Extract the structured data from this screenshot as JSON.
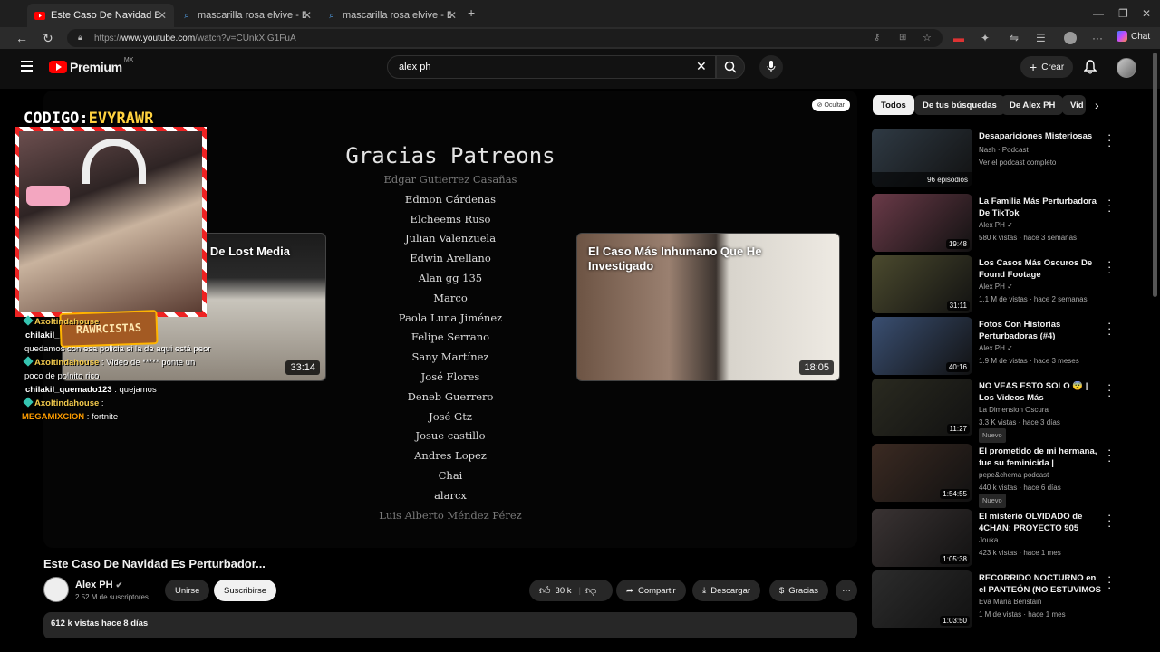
{
  "browser": {
    "tabs": [
      {
        "title": "Este Caso De Navidad Es Perturbador",
        "active": true
      },
      {
        "title": "mascarilla rosa elvive - Búsqueda",
        "active": false
      },
      {
        "title": "mascarilla rosa elvive - Búsqueda",
        "active": false
      }
    ],
    "new_tab": "+",
    "url_prefix": "https://",
    "url_domain": "www.youtube.com",
    "url_path": "/watch?v=CUnkXIG1FuA",
    "chat_label": "Chat"
  },
  "header": {
    "brand": "Premium",
    "region": "MX",
    "search_value": "alex ph",
    "create_label": "Crear"
  },
  "player": {
    "hide_label": "Ocultar",
    "credits_title": "Gracias Patreons",
    "credits": [
      "Edgar Gutierrez Casañas",
      "Edmon Cárdenas",
      "Elcheems Ruso",
      "Julian Valenzuela",
      "Edwin Arellano",
      "Alan gg 135",
      "Marco",
      "Paola Luna Jiménez",
      "Felipe Serrano",
      "Sany Martínez",
      "José Flores",
      "Deneb Guerrero",
      "José Gtz",
      "Josue castillo",
      "Andres Lopez",
      "Chai",
      "alarcx",
      "Luis Alberto Méndez Pérez"
    ],
    "end_card_left": {
      "title": "s De Lost Media",
      "duration": "33:14"
    },
    "end_card_right": {
      "title": "El Caso Más Inhumano Que He Investigado",
      "duration": "18:05"
    }
  },
  "overlay": {
    "code_label": "CODIGO:",
    "code_value": "EVYRAWR",
    "badge": "RAWRCISTAS",
    "chat": [
      {
        "user": "Axoltindahouse",
        "text": ""
      },
      {
        "user": "chilakil_",
        "text": ""
      },
      {
        "user": "",
        "text": "quedamos con esa policia si la de aqui está peor"
      },
      {
        "user": "Axoltindahouse",
        "text": ": Video de ***** ponte un poco de polnito rico"
      },
      {
        "user": "chilakil_quemado123",
        "text": ": quejamos"
      },
      {
        "user": "Axoltindahouse",
        "text": ":"
      },
      {
        "user": "MEGAMIXCION",
        "text": ": fortnite"
      }
    ]
  },
  "video": {
    "title": "Este Caso De Navidad Es Perturbador...",
    "channel": "Alex PH",
    "subscribers": "2.52 M de suscriptores",
    "join_label": "Unirse",
    "subscribe_label": "Suscribirse",
    "likes": "30 k",
    "share_label": "Compartir",
    "download_label": "Descargar",
    "thanks_label": "Gracias",
    "views_date": "612 k vistas  hace 8 días"
  },
  "sidebar": {
    "chips": [
      "Todos",
      "De tus búsquedas",
      "De Alex PH",
      "Vid"
    ],
    "items": [
      {
        "title": "Desapariciones Misteriosas",
        "line1": "Nash · Podcast",
        "line2": "Ver el podcast completo",
        "duration": "96 episodios",
        "thumb_color": "#2f3a44",
        "new": false
      },
      {
        "title": "La Familia Más Perturbadora De TikTok",
        "line1": "Alex PH ✓",
        "line2": "580 k vistas · hace 3 semanas",
        "duration": "19:48",
        "thumb_color": "#6a3a48",
        "new": false
      },
      {
        "title": "Los Casos Más Oscuros De Found Footage",
        "line1": "Alex PH ✓",
        "line2": "1.1 M de vistas · hace 2 semanas",
        "duration": "31:11",
        "thumb_color": "#4b4a2e",
        "new": false
      },
      {
        "title": "Fotos Con Historias Perturbadoras (#4)",
        "line1": "Alex PH ✓",
        "line2": "1.9 M de vistas · hace 3 meses",
        "duration": "40:16",
        "thumb_color": "#3a4f72",
        "new": false
      },
      {
        "title": "NO VEAS ESTO SOLO 😨 | Los Videos Más Perturbadores del...",
        "line1": "La Dimension Oscura",
        "line2": "3.3 K vistas · hace 3 días",
        "duration": "11:27",
        "thumb_color": "#2a2a20",
        "new": true
      },
      {
        "title": "El prometido de mi hermana, fue su feminicida | pepe&che...",
        "line1": "pepe&chema podcast",
        "line2": "440 k vistas · hace 6 días",
        "duration": "1:54:55",
        "thumb_color": "#3b2a22",
        "new": true
      },
      {
        "title": "El misterio OLVIDADO de 4CHAN: PROYECTO 905",
        "line1": "Jouka",
        "line2": "423 k vistas · hace 1 mes",
        "duration": "1:05:38",
        "thumb_color": "#3a3333",
        "new": false
      },
      {
        "title": "RECORRIDO NOCTURNO en el PANTEÓN (NO ESTUVIMOS ...",
        "line1": "Eva Maria Beristain",
        "line2": "1 M de vistas · hace 1 mes",
        "duration": "1:03:50",
        "thumb_color": "#2c2c2c",
        "new": false
      }
    ],
    "new_label": "Nuevo"
  }
}
